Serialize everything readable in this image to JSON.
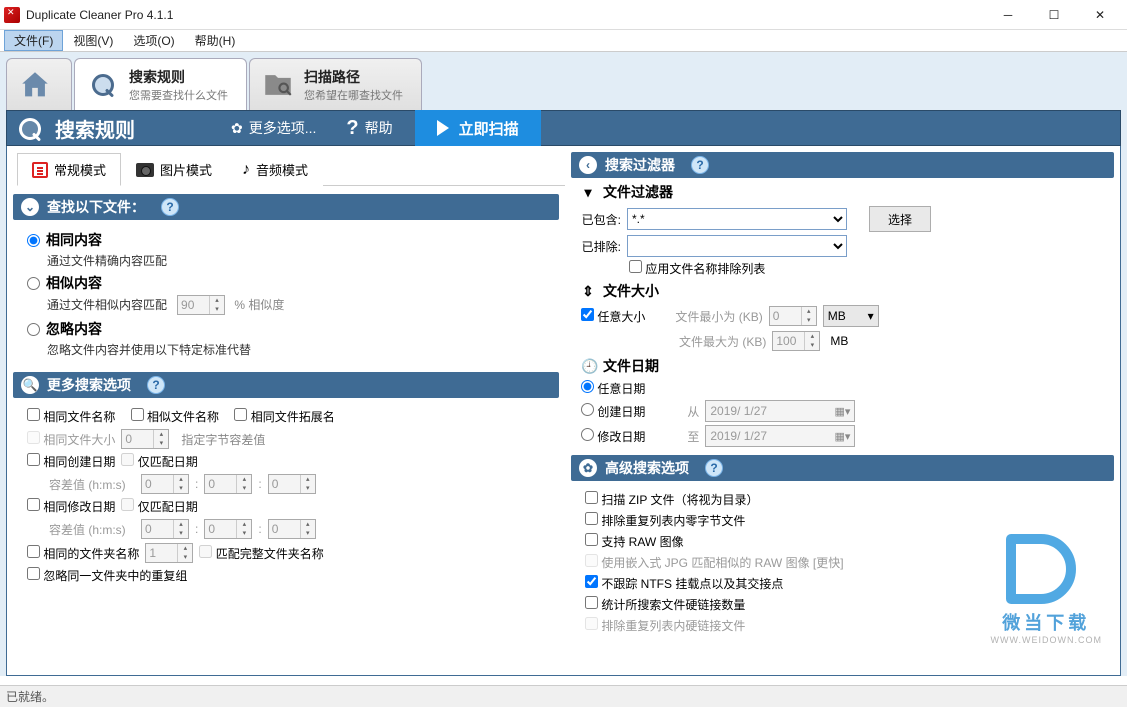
{
  "titlebar": {
    "title": "Duplicate Cleaner Pro 4.1.1"
  },
  "menu": {
    "file": "文件(F)",
    "view": "视图(V)",
    "options": "选项(O)",
    "help": "帮助(H)"
  },
  "bigtabs": {
    "home": "",
    "rules": {
      "title": "搜索规则",
      "sub": "您需要查找什么文件"
    },
    "path": {
      "title": "扫描路径",
      "sub": "您希望在哪查找文件"
    }
  },
  "bluebar": {
    "title": "搜索规则",
    "more": "更多选项...",
    "help": "帮助",
    "scan": "立即扫描"
  },
  "smtabs": {
    "normal": "常规模式",
    "image": "图片模式",
    "audio": "音频模式"
  },
  "left": {
    "sec1_title": "查找以下文件：",
    "r_same": "相同内容",
    "r_same_desc": "通过文件精确内容匹配",
    "r_sim": "相似内容",
    "r_sim_desc": "通过文件相似内容匹配",
    "sim_pct_val": "90",
    "sim_pct_sfx": "% 相似度",
    "r_ign": "忽略内容",
    "r_ign_desc": "忽略文件内容并使用以下特定标准代替",
    "sec2_title": "更多搜索选项",
    "ck_samename": "相同文件名称",
    "ck_simname": "相似文件名称",
    "ck_sameext": "相同文件拓展名",
    "ck_samesize": "相同文件大小",
    "samesize_val": "0",
    "samesize_sfx": "指定字节容差值",
    "ck_cdate": "相同创建日期",
    "ck_dateonly": "仅匹配日期",
    "tol_label": "容差值 (h:m:s)",
    "tol_h": "0",
    "tol_m": "0",
    "tol_s": "0",
    "ck_mdate": "相同修改日期",
    "ck_folder": "相同的文件夹名称",
    "folder_val": "1",
    "ck_folder_full": "匹配完整文件夹名称",
    "ck_igndup": "忽略同一文件夹中的重复组"
  },
  "right": {
    "sec_title": "搜索过滤器",
    "sub_filter": "文件过滤器",
    "incl_label": "已包含:",
    "incl_val": "*.*",
    "excl_label": "已排除:",
    "excl_val": "",
    "select_btn": "选择",
    "ck_namelist": "应用文件名称排除列表",
    "sub_size": "文件大小",
    "ck_anysize": "任意大小",
    "min_label": "文件最小为 (KB)",
    "min_val": "0",
    "min_unit": "MB",
    "max_label": "文件最大为 (KB)",
    "max_val": "100",
    "max_unit": "MB",
    "sub_date": "文件日期",
    "r_anydate": "任意日期",
    "r_cdate": "创建日期",
    "from_label": "从",
    "date1": "2019/ 1/27",
    "r_mdate": "修改日期",
    "to_label": "至",
    "date2": "2019/ 1/27",
    "sec_adv": "高级搜索选项",
    "adv_zip": "扫描 ZIP 文件（将视为目录）",
    "adv_zero": "排除重复列表内零字节文件",
    "adv_raw": "支持 RAW 图像",
    "adv_jpg": "使用嵌入式 JPG 匹配相似的 RAW 图像 [更快]",
    "adv_ntfs": "不跟踪 NTFS 挂载点以及其交接点",
    "adv_hard": "统计所搜索文件硬链接数量",
    "adv_hardex": "排除重复列表内硬链接文件"
  },
  "statusbar": "已就绪。",
  "watermark": {
    "l1": "微当下载",
    "l2": "WWW.WEIDOWN.COM"
  }
}
